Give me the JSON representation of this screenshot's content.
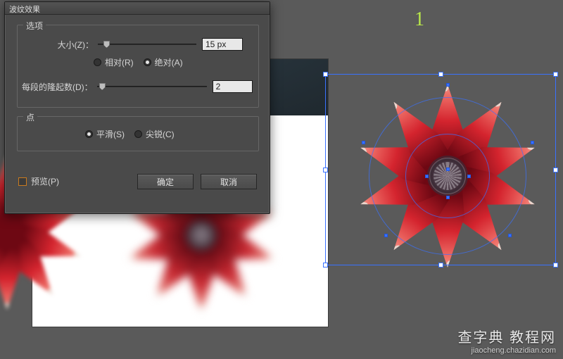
{
  "step_number": "1",
  "dialog": {
    "title": "波纹效果",
    "group_options_label": "选项",
    "group_points_label": "点",
    "size_label": "大小(Z)：",
    "size_value": "15 px",
    "relative_label": "相对(R)",
    "absolute_label": "绝对(A)",
    "ridges_label": "每段的隆起数(D)：",
    "ridges_value": "2",
    "smooth_label": "平滑(S)",
    "corner_label": "尖锐(C)",
    "preview_label": "预览(P)",
    "ok_label": "确定",
    "cancel_label": "取消",
    "size_radio_selected": "absolute",
    "points_radio_selected": "smooth",
    "preview_checked": false
  },
  "colors": {
    "accent_blue": "#3a72ff",
    "step_green": "#b9e84a",
    "petal_red": "#d4242e",
    "petal_dark": "#6e0813",
    "canvas_bg": "#5a5a5a"
  },
  "watermark": {
    "line1": "查字典 教程网",
    "line2": "jiaocheng.chazidian.com"
  }
}
